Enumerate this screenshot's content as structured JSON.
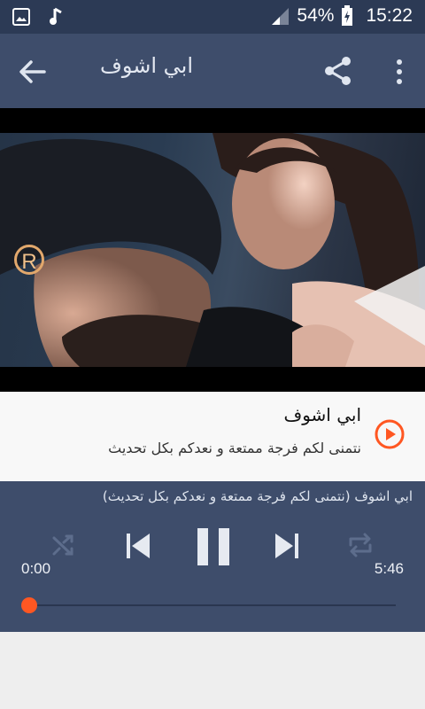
{
  "status_bar": {
    "battery": "54%",
    "time": "15:22"
  },
  "app_bar": {
    "title": "ابي اشوف"
  },
  "track": {
    "title": "ابي اشوف",
    "subtitle": "نتمنى لكم فرجة ممتعة و نعدكم بكل تحديث"
  },
  "player": {
    "now_playing": "ابي اشوف (نتمنى لكم فرجة ممتعة و نعدكم بكل تحديث)",
    "current_time": "0:00",
    "duration": "5:46",
    "progress": 0.0
  },
  "video": {
    "logo_text": "R"
  },
  "colors": {
    "status_bar": "#2c3a55",
    "app_bar": "#3e4d6b",
    "accent": "#ff5722"
  },
  "icons": [
    "image-icon",
    "music-note-icon",
    "signal-icon",
    "battery-icon",
    "back-arrow-icon",
    "share-icon",
    "more-vert-icon",
    "play-circle-icon",
    "shuffle-icon",
    "skip-previous-icon",
    "pause-icon",
    "skip-next-icon",
    "repeat-icon"
  ]
}
